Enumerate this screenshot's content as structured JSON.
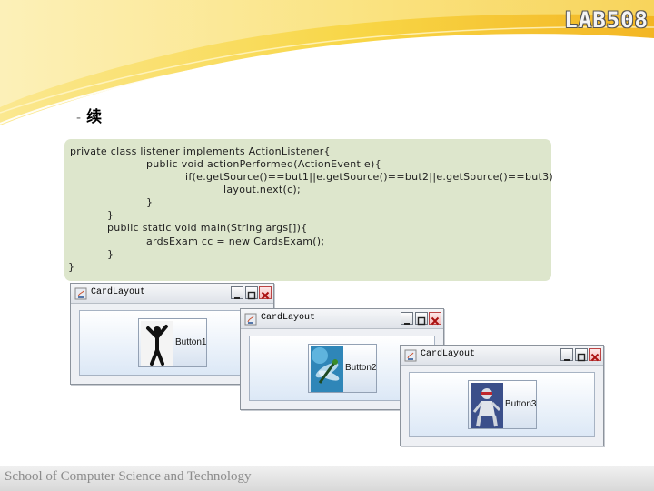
{
  "logo": {
    "text": "LAB508"
  },
  "subtitle": {
    "dash": "-",
    "text": "续"
  },
  "code": {
    "lines": [
      "private class listener implements ActionListener{",
      "public void actionPerformed(ActionEvent e){",
      "if(e.getSource()==but1||e.getSource()==but2||e.getSource()==but3)",
      "layout.next(c);",
      "}",
      "}",
      "public static void main(String args[]){",
      "ardsExam cc = new CardsExam();",
      "}",
      "}"
    ]
  },
  "windows": [
    {
      "title": "CardLayout",
      "button_label": "Button1",
      "icon": "silhouette-figure-icon"
    },
    {
      "title": "CardLayout",
      "button_label": "Button2",
      "icon": "dragonfly-icon"
    },
    {
      "title": "CardLayout",
      "button_label": "Button3",
      "icon": "robot-figure-icon"
    }
  ],
  "footer": {
    "text": "School of Computer Science and Technology"
  },
  "colors": {
    "code_bg": "#dde6cc",
    "swoosh_yellow": "#f7d23a",
    "swoosh_orange": "#f2a522",
    "footer_text": "#8c8c8c"
  }
}
